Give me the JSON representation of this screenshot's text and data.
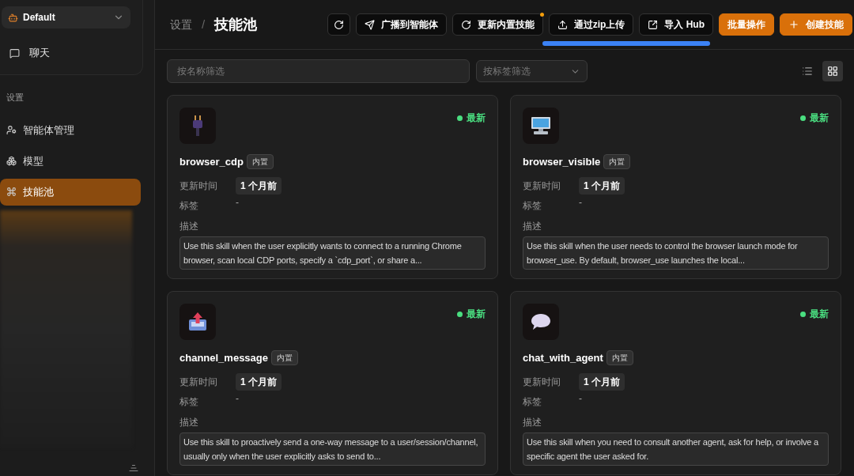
{
  "sidebar": {
    "agent_selector": {
      "value": "Default"
    },
    "nav_items": [
      {
        "label": "聊天"
      }
    ],
    "section_label": "设置",
    "settings_items": [
      {
        "label": "智能体管理",
        "selected": false
      },
      {
        "label": "模型",
        "selected": false
      },
      {
        "label": "技能池",
        "selected": true
      }
    ]
  },
  "header": {
    "breadcrumb": [
      "设置",
      "技能池"
    ],
    "separator": "/",
    "buttons": [
      {
        "kind": "icon",
        "badge": false
      },
      {
        "kind": "outline",
        "label": "广播到智能体",
        "badge": false
      },
      {
        "kind": "outline",
        "label": "更新内置技能",
        "badge": true
      },
      {
        "kind": "outline",
        "label": "通过zip上传",
        "badge": false
      },
      {
        "kind": "outline",
        "label": "导入 Hub",
        "badge": false
      },
      {
        "kind": "primary",
        "label": "批量操作",
        "badge": false
      },
      {
        "kind": "primary",
        "label": "创建技能",
        "badge": false
      }
    ]
  },
  "filters": {
    "name_filter": {
      "placeholder": "按名称筛选"
    },
    "tag_filter": {
      "placeholder": "按标签筛选"
    },
    "view_toggle": [
      {
        "selected": false
      },
      {
        "selected": true
      }
    ]
  },
  "skills": [
    {
      "name": "browser_cdp",
      "tag": "内置",
      "status": "最新",
      "updated_label": "更新时间",
      "updated": "1 个月前",
      "tags_label": "标签",
      "tags": "-",
      "desc_label": "描述",
      "description": "Use this skill when the user explicitly wants to connect to a running Chrome browser, scan local CDP ports, specify a `cdp_port`, or share a..."
    },
    {
      "name": "browser_visible",
      "tag": "内置",
      "status": "最新",
      "updated_label": "更新时间",
      "updated": "1 个月前",
      "tags_label": "标签",
      "tags": "-",
      "desc_label": "描述",
      "description": "Use this skill when the user needs to control the browser launch mode for browser_use. By default, browser_use launches the local..."
    },
    {
      "name": "channel_message",
      "tag": "内置",
      "status": "最新",
      "updated_label": "更新时间",
      "updated": "1 个月前",
      "tags_label": "标签",
      "tags": "-",
      "desc_label": "描述",
      "description": "Use this skill to proactively send a one-way message to a user/session/channel, usually only when the user explicitly asks to send to..."
    },
    {
      "name": "chat_with_agent",
      "tag": "内置",
      "status": "最新",
      "updated_label": "更新时间",
      "updated": "1 个月前",
      "tags_label": "标签",
      "tags": "-",
      "desc_label": "描述",
      "description": "Use this skill when you need to consult another agent, ask for help, or involve a specific agent the user asked for."
    }
  ]
}
